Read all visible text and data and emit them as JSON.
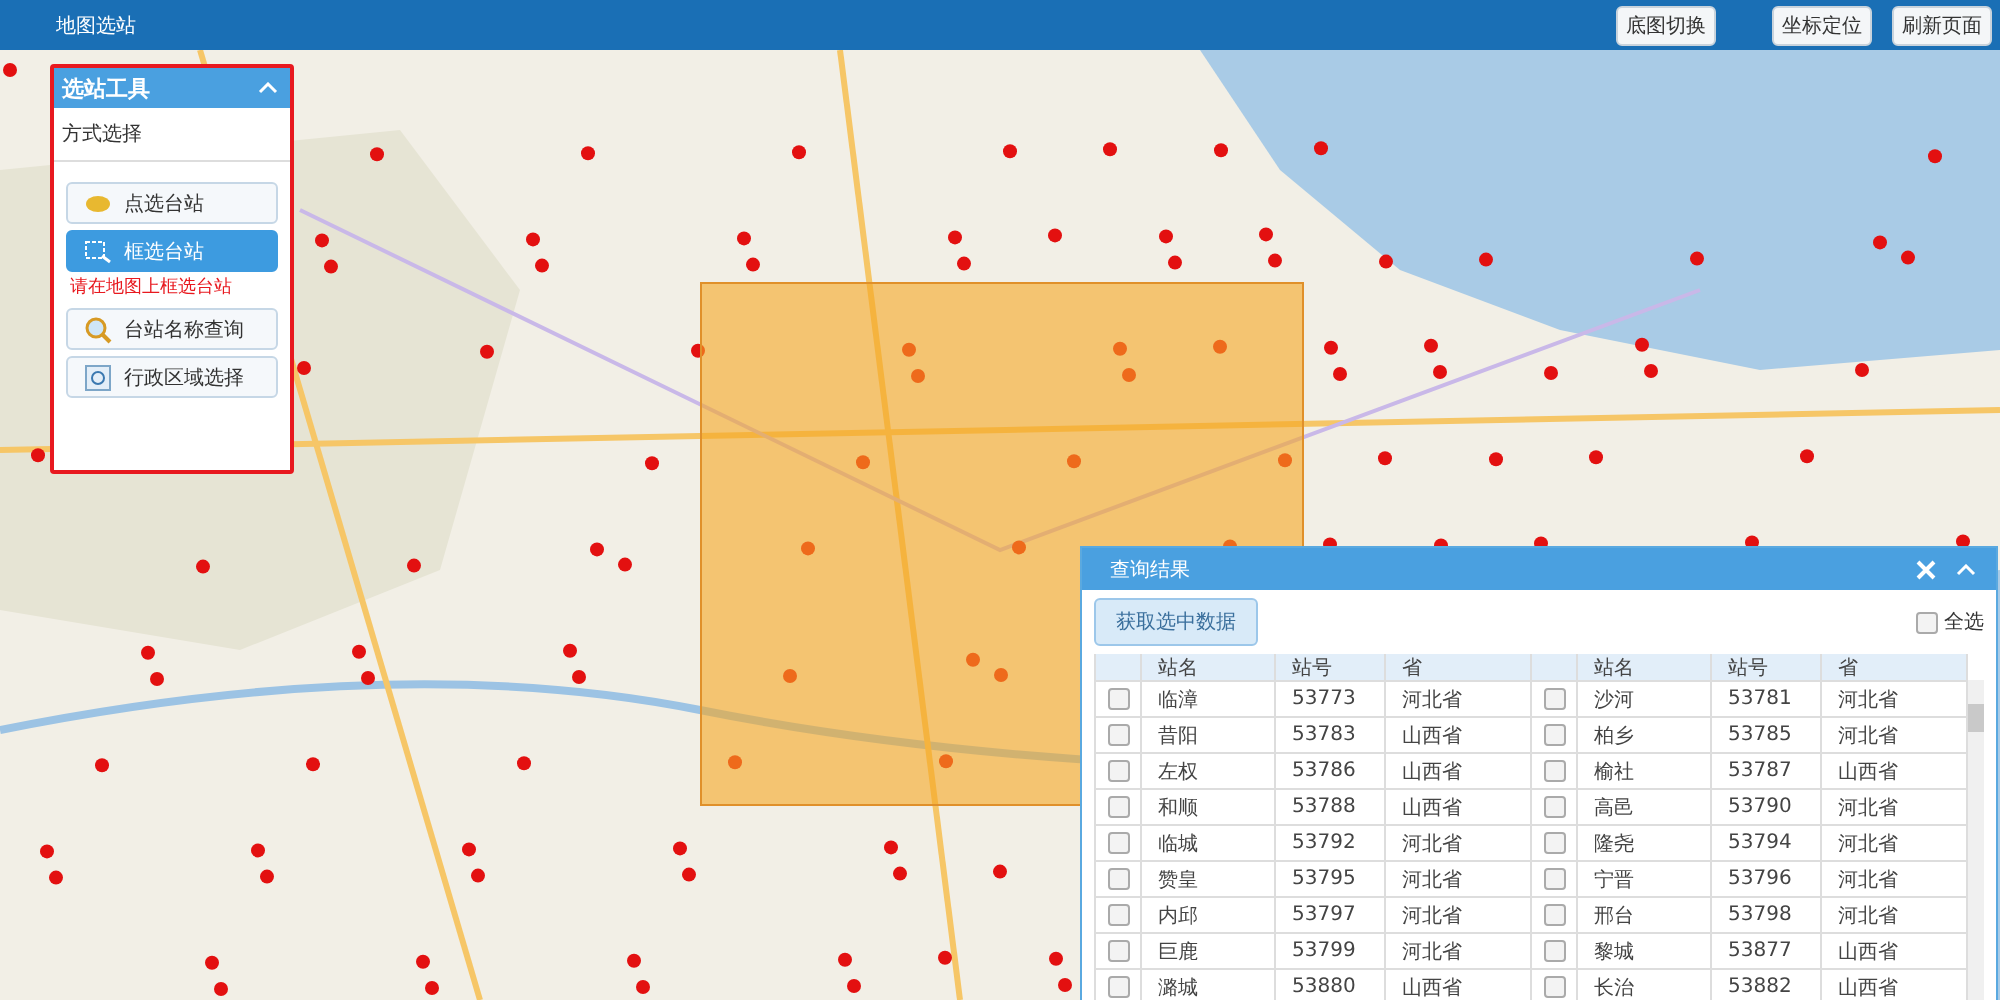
{
  "header": {
    "title": "地图选站",
    "buttons": [
      "底图切换",
      "坐标定位",
      "刷新页面"
    ]
  },
  "tool_panel": {
    "title": "选站工具",
    "expanded": true,
    "section": "方式选择",
    "hint": "请在地图上框选台站",
    "modes": [
      {
        "label": "点选台站",
        "selected": false
      },
      {
        "label": "框选台站",
        "selected": true
      },
      {
        "label": "台站名称查询",
        "selected": false
      },
      {
        "label": "行政区域选择",
        "selected": false
      }
    ]
  },
  "selection": {
    "visible": true
  },
  "results": {
    "title": "查询结果",
    "action": "获取选中数据",
    "select_all": {
      "label": "全选",
      "checked": false
    },
    "columns": [
      "",
      "站名",
      "站号",
      "省",
      "",
      "站名",
      "站号",
      "省"
    ],
    "rows": [
      [
        {
          "checked": false
        },
        "临漳",
        "53773",
        "河北省",
        {
          "checked": false
        },
        "沙河",
        "53781",
        "河北省"
      ],
      [
        {
          "checked": false
        },
        "昔阳",
        "53783",
        "山西省",
        {
          "checked": false
        },
        "柏乡",
        "53785",
        "河北省"
      ],
      [
        {
          "checked": false
        },
        "左权",
        "53786",
        "山西省",
        {
          "checked": false
        },
        "榆社",
        "53787",
        "山西省"
      ],
      [
        {
          "checked": false
        },
        "和顺",
        "53788",
        "山西省",
        {
          "checked": false
        },
        "高邑",
        "53790",
        "河北省"
      ],
      [
        {
          "checked": false
        },
        "临城",
        "53792",
        "河北省",
        {
          "checked": false
        },
        "隆尧",
        "53794",
        "河北省"
      ],
      [
        {
          "checked": false
        },
        "赞皇",
        "53795",
        "河北省",
        {
          "checked": false
        },
        "宁晋",
        "53796",
        "河北省"
      ],
      [
        {
          "checked": false
        },
        "内邱",
        "53797",
        "河北省",
        {
          "checked": false
        },
        "邢台",
        "53798",
        "河北省"
      ],
      [
        {
          "checked": false
        },
        "巨鹿",
        "53799",
        "河北省",
        {
          "checked": false
        },
        "黎城",
        "53877",
        "山西省"
      ],
      [
        {
          "checked": false
        },
        "潞城",
        "53880",
        "山西省",
        {
          "checked": false
        },
        "长治",
        "53882",
        "山西省"
      ]
    ]
  }
}
